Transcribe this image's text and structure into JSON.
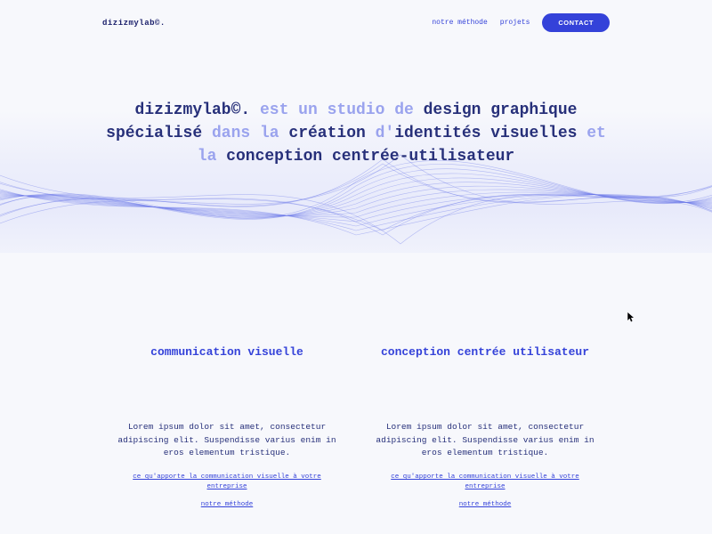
{
  "header": {
    "logo": "dizizmylab©.",
    "nav": {
      "method": "notre méthode",
      "projects": "projets",
      "contact": "CONTACT"
    }
  },
  "hero": {
    "p1": "dizizmylab©.",
    "p2": " est un studio de ",
    "p3": "design graphique",
    "p4": "spécialisé",
    "p5": " dans la ",
    "p6": "création",
    "p7": " d'",
    "p8": "identités visuelles",
    "p9": " et la ",
    "p10": "conception centrée-utilisateur"
  },
  "sections": {
    "left": {
      "title": "communication visuelle",
      "body": "Lorem ipsum dolor sit amet, consectetur adipiscing elit. Suspendisse varius enim in eros elementum tristique.",
      "link1": "ce qu'apporte la communication visuelle à votre entreprise",
      "link2": "notre méthode"
    },
    "right": {
      "title": "conception centrée utilisateur",
      "body": "Lorem ipsum dolor sit amet, consectetur adipiscing elit. Suspendisse varius enim in eros elementum tristique.",
      "link1": "ce qu'apporte la communication visuelle à votre entreprise",
      "link2": "notre méthode"
    }
  }
}
